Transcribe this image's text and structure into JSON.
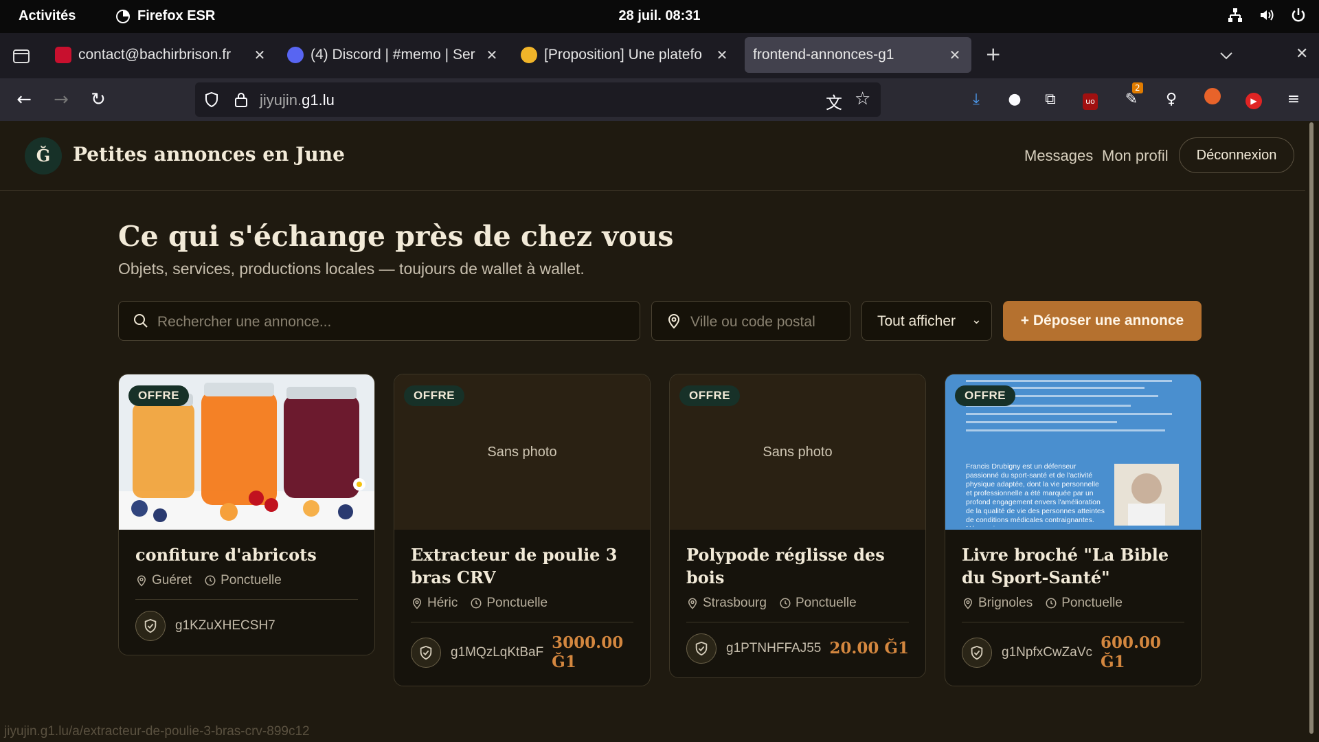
{
  "system": {
    "activities": "Activités",
    "app_name": "Firefox ESR",
    "clock": "28 juil.  08:31"
  },
  "tabs": [
    {
      "title": "contact@bachirbrison.fr",
      "favicon_color": "#c8102e"
    },
    {
      "title": "(4) Discord | #memo | Ser",
      "favicon_color": "#5865f2"
    },
    {
      "title": "[Proposition] Une platefo",
      "favicon_color": "#f0b429"
    },
    {
      "title": "frontend-annonces-g1",
      "favicon_color": ""
    }
  ],
  "browser": {
    "url_host_prefix": "jiyujin.",
    "url_host_main": "g1.lu",
    "extension_badge": "2"
  },
  "site": {
    "logo_letter": "Ğ",
    "title": "Petites annonces en June",
    "nav": {
      "messages": "Messages",
      "profile": "Mon profil",
      "logout": "Déconnexion"
    },
    "hero_title": "Ce qui s'échange près de chez vous",
    "hero_subtitle": "Objets, services, productions locales — toujours de wallet à wallet.",
    "search_placeholder": "Rechercher une annonce...",
    "location_placeholder": "Ville ou code postal",
    "filter_value": "Tout afficher",
    "cta": "+ Déposer une annonce"
  },
  "listings": [
    {
      "badge": "OFFRE",
      "title": "confiture d'abricots",
      "city": "Guéret",
      "frequency": "Ponctuelle",
      "seller": "g1KZuXHECSH7",
      "price": "",
      "photo": "jam"
    },
    {
      "badge": "OFFRE",
      "title": "Extracteur de poulie 3 bras CRV",
      "city": "Héric",
      "frequency": "Ponctuelle",
      "seller": "g1MQzLqKtBaF",
      "price": "3000.00 Ğ1",
      "photo": "none",
      "no_photo_label": "Sans photo"
    },
    {
      "badge": "OFFRE",
      "title": "Polypode réglisse des bois",
      "city": "Strasbourg",
      "frequency": "Ponctuelle",
      "seller": "g1PTNHFFAJ55",
      "price": "20.00 Ğ1",
      "photo": "none",
      "no_photo_label": "Sans photo"
    },
    {
      "badge": "OFFRE",
      "title": "Livre broché \"La Bible du Sport-Santé\"",
      "city": "Brignoles",
      "frequency": "Ponctuelle",
      "seller": "g1NpfxCwZaVc",
      "price": "600.00 Ğ1",
      "photo": "book",
      "book_text": "Francis Drubigny est un défenseur passionné du sport-santé et de l'activité physique adaptée, dont la vie personnelle et professionnelle a été marquée par un profond engagement envers l'amélioration de la qualité de vie des personnes atteintes de conditions médicales contraignantes. Néanmoins"
    }
  ],
  "status_url": "jiyujin.g1.lu/a/extracteur-de-poulie-3-bras-crv-899c12",
  "colors": {
    "accent": "#b5712f",
    "price": "#d4873f",
    "badge_bg": "#173128",
    "page_bg": "#1f1a10"
  }
}
